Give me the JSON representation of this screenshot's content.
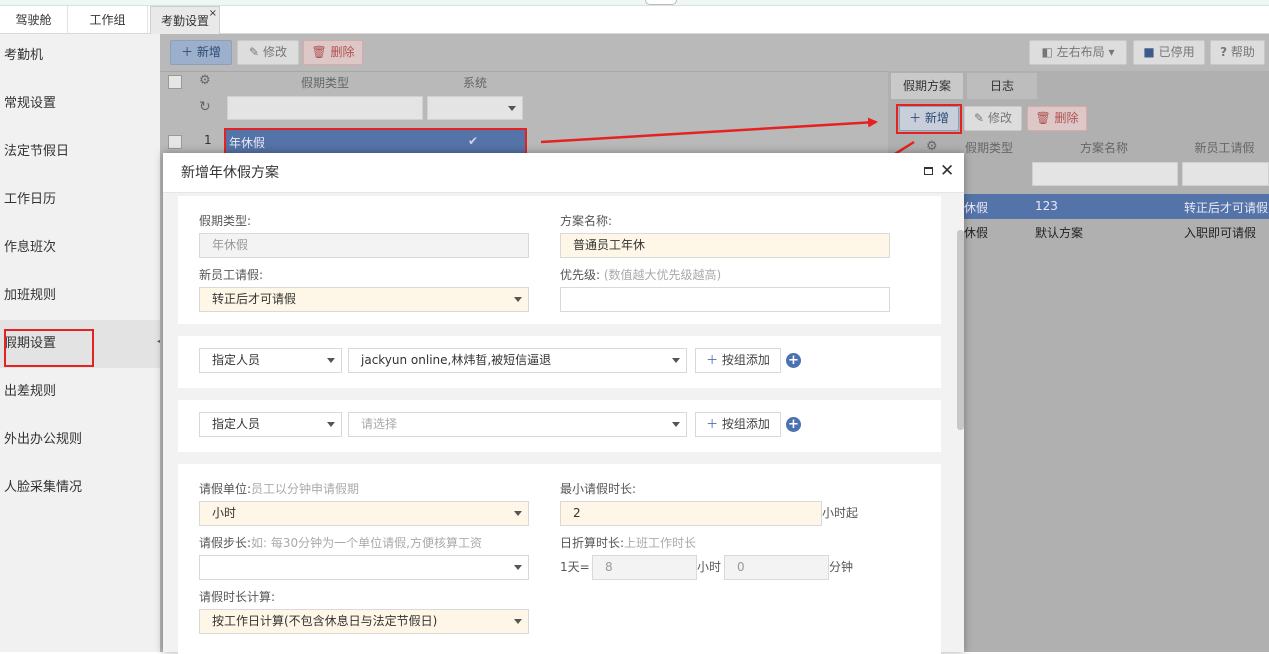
{
  "tabs": [
    {
      "label": "驾驶舱"
    },
    {
      "label": "工作组"
    },
    {
      "label": "考勤设置",
      "close": "×"
    }
  ],
  "sidebar": {
    "items": [
      {
        "label": "考勤机"
      },
      {
        "label": "常规设置"
      },
      {
        "label": "法定节假日"
      },
      {
        "label": "工作日历"
      },
      {
        "label": "作息班次"
      },
      {
        "label": "加班规则"
      },
      {
        "label": "假期设置"
      },
      {
        "label": "出差规则"
      },
      {
        "label": "外出办公规则"
      },
      {
        "label": "人脸采集情况"
      }
    ],
    "collapse_glyph": "◂"
  },
  "toolbar": {
    "add": "新增",
    "edit": "修改",
    "delete": "删除",
    "layout": "左右布局",
    "disabled": "已停用",
    "help": "帮助",
    "help_glyph": "?"
  },
  "left_grid": {
    "headers": {
      "type": "假期类型",
      "system": "系统"
    },
    "rows": [
      {
        "index": "1",
        "type": "年休假",
        "system_check": "✔"
      }
    ]
  },
  "right_panel": {
    "tabs": [
      "假期方案",
      "日志"
    ],
    "toolbar": {
      "add": "新增",
      "edit": "修改",
      "delete": "删除"
    },
    "headers": {
      "type": "假期类型",
      "name": "方案名称",
      "newbie": "新员工请假"
    },
    "rows": [
      {
        "type": "休假",
        "name": "123",
        "newbie": "转正后才可请假"
      },
      {
        "type": "休假",
        "name": "默认方案",
        "newbie": "入职即可请假"
      }
    ]
  },
  "dialog": {
    "title": "新增年休假方案",
    "leave_type_label": "假期类型:",
    "leave_type_value": "年休假",
    "plan_name_label": "方案名称:",
    "plan_name_value": "普通员工年休",
    "newbie_label": "新员工请假:",
    "newbie_value": "转正后才可请假",
    "priority_label": "优先级:",
    "priority_hint": "(数值越大优先级越高)",
    "priority_value": "",
    "scope1": {
      "type": "指定人员",
      "people": "jackyun online,林炜晢,被短信逼退",
      "add_group": "按组添加"
    },
    "scope2": {
      "type": "指定人员",
      "placeholder": "请选择",
      "add_group": "按组添加"
    },
    "unit_label": "请假单位:",
    "unit_hint": "员工以分钟申请假期",
    "unit_value": "小时",
    "min_label": "最小请假时长:",
    "min_value": "2",
    "min_suffix": "小时起",
    "step_label": "请假步长:",
    "step_hint": "如: 每30分钟为一个单位请假,方便核算工资",
    "step_value": "",
    "convert_label": "日折算时长:",
    "convert_hint": "上班工作时长",
    "convert_prefix": "1天=",
    "convert_hours": "8",
    "hours_unit": "小时",
    "convert_minutes": "0",
    "minutes_unit": "分钟",
    "calc_label": "请假时长计算:",
    "calc_value": "按工作日计算(不包含休息日与法定节假日)"
  },
  "colors": {
    "annotation_red": "#e52222",
    "selected_row": "#5473a8",
    "overlay_gray": "#b9b9b9",
    "input_warm": "#fef6e6"
  }
}
